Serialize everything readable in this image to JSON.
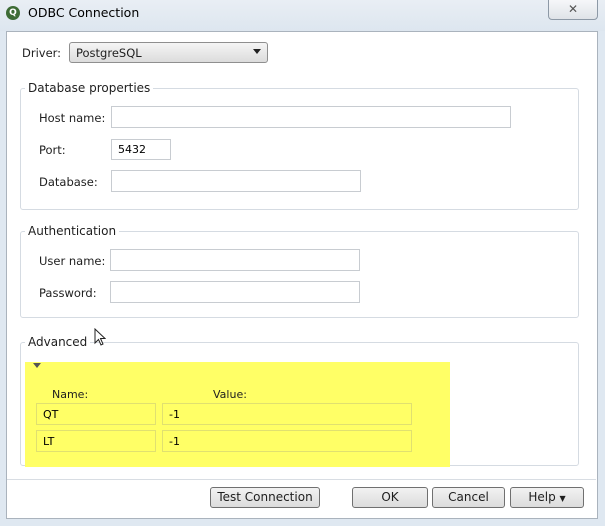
{
  "window": {
    "title": "ODBC Connection",
    "close_icon": "close-icon"
  },
  "driver": {
    "label": "Driver:",
    "value": "PostgreSQL"
  },
  "database_properties": {
    "legend": "Database properties",
    "host_label": "Host name:",
    "host_value": "",
    "port_label": "Port:",
    "port_value": "5432",
    "database_label": "Database:",
    "database_value": ""
  },
  "authentication": {
    "legend": "Authentication",
    "user_label": "User name:",
    "user_value": "",
    "password_label": "Password:",
    "password_value": ""
  },
  "advanced": {
    "legend": "Advanced",
    "name_header": "Name:",
    "value_header": "Value:",
    "highlight_color": "#ffff66",
    "rows": [
      {
        "name": "QT",
        "value": "-1"
      },
      {
        "name": "LT",
        "value": "-1"
      }
    ]
  },
  "buttons": {
    "test": "Test Connection",
    "ok": "OK",
    "cancel": "Cancel",
    "help": "Help"
  }
}
